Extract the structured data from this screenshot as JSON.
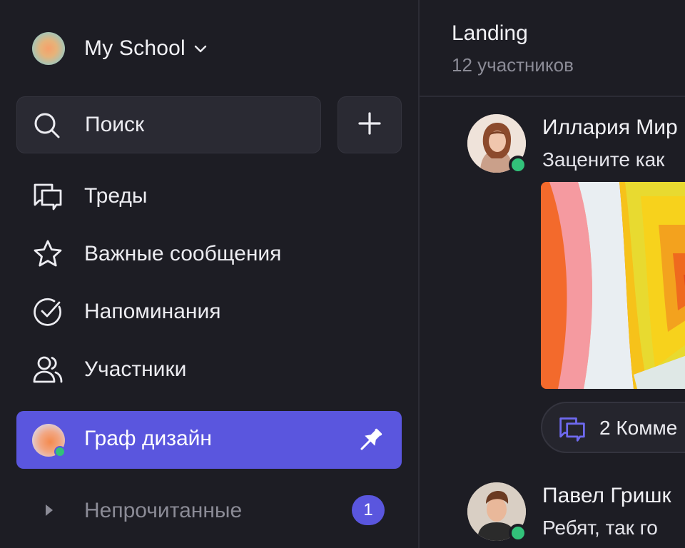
{
  "workspace": {
    "name": "My School"
  },
  "search": {
    "label": "Поиск"
  },
  "nav": {
    "threads": "Треды",
    "starred": "Важные сообщения",
    "reminders": "Напоминания",
    "members": "Участники"
  },
  "channel": {
    "active_name": "Граф дизайн"
  },
  "unread": {
    "label": "Непрочитанные",
    "count": "1"
  },
  "chat": {
    "title": "Landing",
    "subtitle": "12 участников",
    "messages": [
      {
        "author": "Иллария Мир",
        "text": "Зацените как",
        "comments_label": "2 Комме"
      },
      {
        "author": "Павел Гришк",
        "text": "Ребят, так го"
      }
    ]
  },
  "colors": {
    "accent": "#5a56de",
    "online": "#32c27a",
    "background": "#1d1d24",
    "surface": "#2a2a33"
  }
}
